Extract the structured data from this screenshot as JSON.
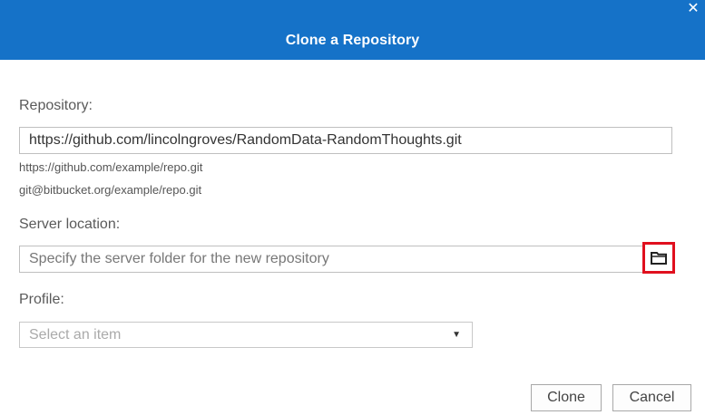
{
  "dialog": {
    "title": "Clone a Repository",
    "close_icon": "close-icon"
  },
  "repository": {
    "label": "Repository:",
    "value": "https://github.com/lincolngroves/RandomData-RandomThoughts.git",
    "hint_https": "https://github.com/example/repo.git",
    "hint_ssh": "git@bitbucket.org/example/repo.git"
  },
  "server_location": {
    "label": "Server location:",
    "placeholder": "Specify the server folder for the new repository",
    "browse_icon": "folder-icon"
  },
  "profile": {
    "label": "Profile:",
    "selected": "Select an item"
  },
  "buttons": {
    "clone": "Clone",
    "cancel": "Cancel"
  },
  "colors": {
    "header": "#1572c8",
    "highlight": "#e0101e"
  }
}
